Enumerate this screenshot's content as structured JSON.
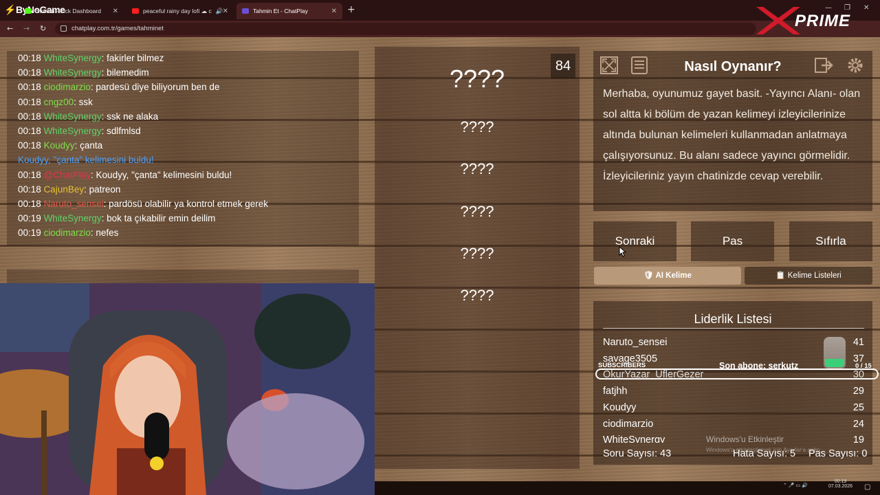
{
  "browser": {
    "brand": "ByNoGame",
    "tabs": [
      {
        "title": "Stream - Kick Dashboard",
        "active": false
      },
      {
        "title": "peaceful rainy day lofi ☁ c",
        "active": false
      },
      {
        "title": "Tahmin Et - ChatPlay",
        "active": true
      }
    ],
    "new_tab": "+",
    "url": "chatplay.com.tr/games/tahminet",
    "overlay_logo": "XPRIME"
  },
  "chat": {
    "lines": [
      {
        "time": "00:18",
        "user": "WhiteSynergy",
        "color": "#5fd36a",
        "msg": ": fakirler bilmez"
      },
      {
        "time": "00:18",
        "user": "WhiteSynergy",
        "color": "#5fd36a",
        "msg": ": bilemedim"
      },
      {
        "time": "00:18",
        "user": "ciodimarzio",
        "color": "#7ee04a",
        "msg": ": pardesü diye biliyorum ben de"
      },
      {
        "time": "00:18",
        "user": "cngz00",
        "color": "#7ee04a",
        "msg": ": ssk"
      },
      {
        "time": "00:18",
        "user": "WhiteSynergy",
        "color": "#5fd36a",
        "msg": ": ssk ne alaka"
      },
      {
        "time": "00:18",
        "user": "WhiteSynergy",
        "color": "#5fd36a",
        "msg": ": sdlfmlsd"
      },
      {
        "time": "00:18",
        "user": "Koudyy",
        "color": "#7ee04a",
        "msg": ": çanta"
      },
      {
        "system": "Koudyy, \"çanta\" kelimesini buldu!"
      },
      {
        "time": "00:18",
        "user": "@ChatPlay",
        "color": "#e0334a",
        "msg": ": Koudyy, \"çanta\" kelimesini buldu!"
      },
      {
        "time": "00:18",
        "user": "CajunBey",
        "color": "#e3c233",
        "msg": ": patreon"
      },
      {
        "time": "00:18",
        "user": "Naruto_sensei",
        "color": "#e05a4a",
        "msg": ": pardösü olabilir ya kontrol etmek gerek"
      },
      {
        "time": "00:19",
        "user": "WhiteSynergy",
        "color": "#5fd36a",
        "msg": ": bok ta çıkabilir emin deilim"
      },
      {
        "time": "00:19",
        "user": "ciodimarzio",
        "color": "#7ee04a",
        "msg": ": nefes"
      }
    ]
  },
  "game": {
    "timer": "84",
    "words": [
      "????",
      "????",
      "????",
      "????",
      "????",
      "????"
    ]
  },
  "howto": {
    "title": "Nasıl Oynanır?",
    "text": "Merhaba, oyunumuz gayet basit. -Yayıncı Alanı- olan sol altta ki bölüm de yazan kelimeyi izleyicilerinize altında bulunan kelimeleri kullanmadan anlatmaya çalışıyorsunuz. Bu alanı sadece yayıncı görmelidir. İzleyicileriniz yayın chatinizde cevap verebilir."
  },
  "controls": {
    "next": "Sonraki",
    "pass": "Pas",
    "reset": "Sıfırla",
    "ai_word": "AI Kelime",
    "word_lists": "Kelime Listeleri"
  },
  "leaderboard": {
    "title": "Liderlik Listesi",
    "rows": [
      {
        "name": "Naruto_sensei",
        "score": "41"
      },
      {
        "name": "savage3505",
        "score": "37"
      },
      {
        "name": "OkurYazar_UflerGezer",
        "score": "30"
      },
      {
        "name": "fatjhh",
        "score": "29"
      },
      {
        "name": "Koudyy",
        "score": "25"
      },
      {
        "name": "ciodimarzio",
        "score": "24"
      },
      {
        "name": "WhiteSynergy",
        "score": "19"
      }
    ],
    "question_count": "Soru Sayısı: 43",
    "error_count": "Hata Sayısı: 5",
    "pass_count": "Pas Sayısı: 0"
  },
  "overlay": {
    "subscribers_label": "SUBSCRIBERS",
    "last_sub": "Son abone: serkutz",
    "sub_count": "0 / 15"
  },
  "windows": {
    "activate_title": "Windows'u Etkinleştir",
    "activate_sub": "Windows'u etkinleştirmek için Ayarlar'a gidin.",
    "time": "00:19",
    "date": "07.03.2026"
  },
  "colors": {
    "system_msg": "#4aa0ff",
    "ai_button": "#b89a7a",
    "accent_red": "#d01b2a"
  }
}
